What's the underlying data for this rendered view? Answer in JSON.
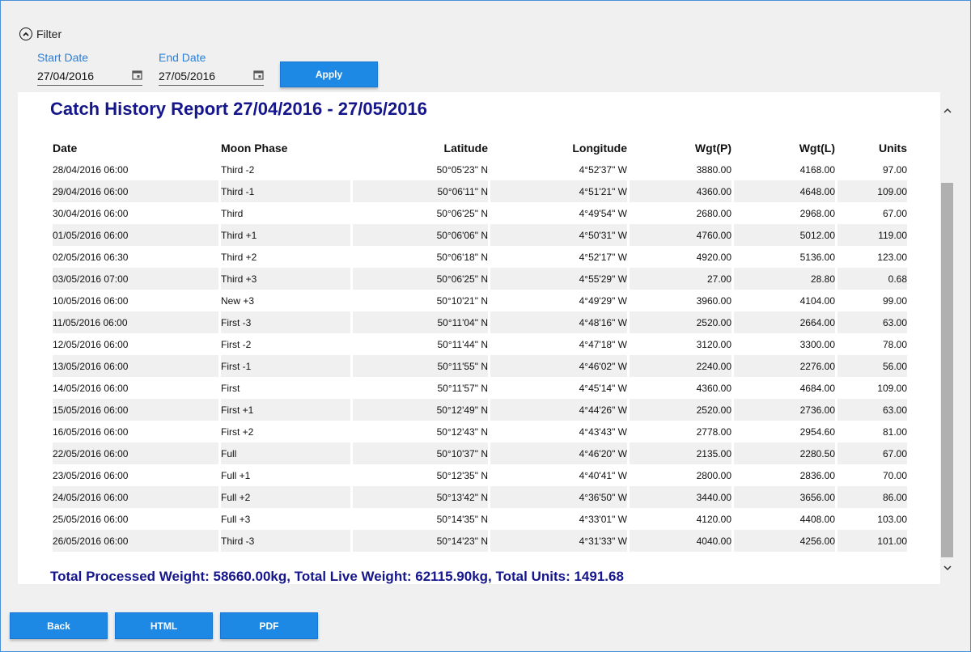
{
  "filter": {
    "toggle_label": "Filter",
    "start_label": "Start Date",
    "start_value": "27/04/2016",
    "end_label": "End Date",
    "end_value": "27/05/2016",
    "apply_label": "Apply"
  },
  "report": {
    "title": "Catch History Report 27/04/2016 - 27/05/2016",
    "columns": [
      "Date",
      "Moon Phase",
      "Latitude",
      "Longitude",
      "Wgt(P)",
      "Wgt(L)",
      "Units"
    ],
    "rows": [
      [
        "28/04/2016 06:00",
        "Third -2",
        "50°05'23\" N",
        "4°52'37\" W",
        "3880.00",
        "4168.00",
        "97.00"
      ],
      [
        "29/04/2016 06:00",
        "Third -1",
        "50°06'11\" N",
        "4°51'21\" W",
        "4360.00",
        "4648.00",
        "109.00"
      ],
      [
        "30/04/2016 06:00",
        "Third",
        "50°06'25\" N",
        "4°49'54\" W",
        "2680.00",
        "2968.00",
        "67.00"
      ],
      [
        "01/05/2016 06:00",
        "Third +1",
        "50°06'06\" N",
        "4°50'31\" W",
        "4760.00",
        "5012.00",
        "119.00"
      ],
      [
        "02/05/2016 06:30",
        "Third +2",
        "50°06'18\" N",
        "4°52'17\" W",
        "4920.00",
        "5136.00",
        "123.00"
      ],
      [
        "03/05/2016 07:00",
        "Third +3",
        "50°06'25\" N",
        "4°55'29\" W",
        "27.00",
        "28.80",
        "0.68"
      ],
      [
        "10/05/2016 06:00",
        "New +3",
        "50°10'21\" N",
        "4°49'29\" W",
        "3960.00",
        "4104.00",
        "99.00"
      ],
      [
        "11/05/2016 06:00",
        "First -3",
        "50°11'04\" N",
        "4°48'16\" W",
        "2520.00",
        "2664.00",
        "63.00"
      ],
      [
        "12/05/2016 06:00",
        "First -2",
        "50°11'44\" N",
        "4°47'18\" W",
        "3120.00",
        "3300.00",
        "78.00"
      ],
      [
        "13/05/2016 06:00",
        "First -1",
        "50°11'55\" N",
        "4°46'02\" W",
        "2240.00",
        "2276.00",
        "56.00"
      ],
      [
        "14/05/2016 06:00",
        "First",
        "50°11'57\" N",
        "4°45'14\" W",
        "4360.00",
        "4684.00",
        "109.00"
      ],
      [
        "15/05/2016 06:00",
        "First +1",
        "50°12'49\" N",
        "4°44'26\" W",
        "2520.00",
        "2736.00",
        "63.00"
      ],
      [
        "16/05/2016 06:00",
        "First +2",
        "50°12'43\" N",
        "4°43'43\" W",
        "2778.00",
        "2954.60",
        "81.00"
      ],
      [
        "22/05/2016 06:00",
        "Full",
        "50°10'37\" N",
        "4°46'20\" W",
        "2135.00",
        "2280.50",
        "67.00"
      ],
      [
        "23/05/2016 06:00",
        "Full +1",
        "50°12'35\" N",
        "4°40'41\" W",
        "2800.00",
        "2836.00",
        "70.00"
      ],
      [
        "24/05/2016 06:00",
        "Full +2",
        "50°13'42\" N",
        "4°36'50\" W",
        "3440.00",
        "3656.00",
        "86.00"
      ],
      [
        "25/05/2016 06:00",
        "Full +3",
        "50°14'35\" N",
        "4°33'01\" W",
        "4120.00",
        "4408.00",
        "103.00"
      ],
      [
        "26/05/2016 06:00",
        "Third -3",
        "50°14'23\" N",
        "4°31'33\" W",
        "4040.00",
        "4256.00",
        "101.00"
      ]
    ],
    "totals": "Total Processed Weight: 58660.00kg, Total Live Weight: 62115.90kg, Total Units: 1491.68"
  },
  "footer": {
    "back_label": "Back",
    "html_label": "HTML",
    "pdf_label": "PDF"
  },
  "colors": {
    "accent": "#1e88e5",
    "title": "#15158c",
    "label": "#2b7fd6"
  }
}
